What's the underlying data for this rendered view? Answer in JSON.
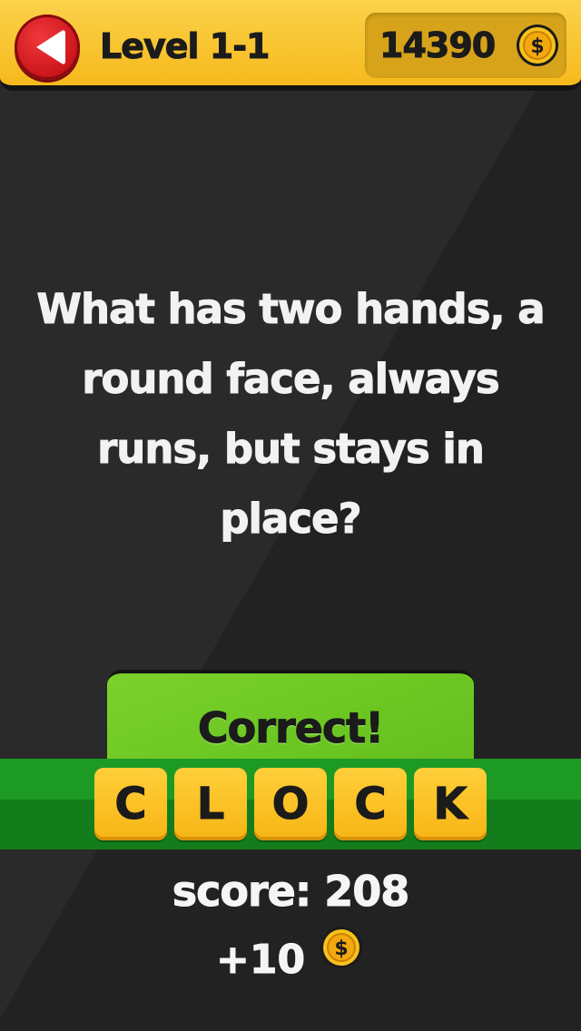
{
  "header": {
    "level_title": "Level 1-1",
    "coin_count": "14390",
    "coin_symbol": "$"
  },
  "question": "What has two hands, a round face, always runs, but stays in place?",
  "result": {
    "label": "Correct!"
  },
  "answer": {
    "letters": [
      "C",
      "L",
      "O",
      "C",
      "K"
    ]
  },
  "score": {
    "label": "score: 208"
  },
  "reward": {
    "amount": "+10",
    "coin_symbol": "$"
  },
  "colors": {
    "header": "#f6b91c",
    "background": "#222222",
    "correct_panel": "#6cc622",
    "answer_strip": "#1c9a24",
    "tile": "#f7b514",
    "back_button": "#d81e24"
  },
  "icons": {
    "back": "back-arrow-icon",
    "coin": "dollar-coin-icon"
  }
}
